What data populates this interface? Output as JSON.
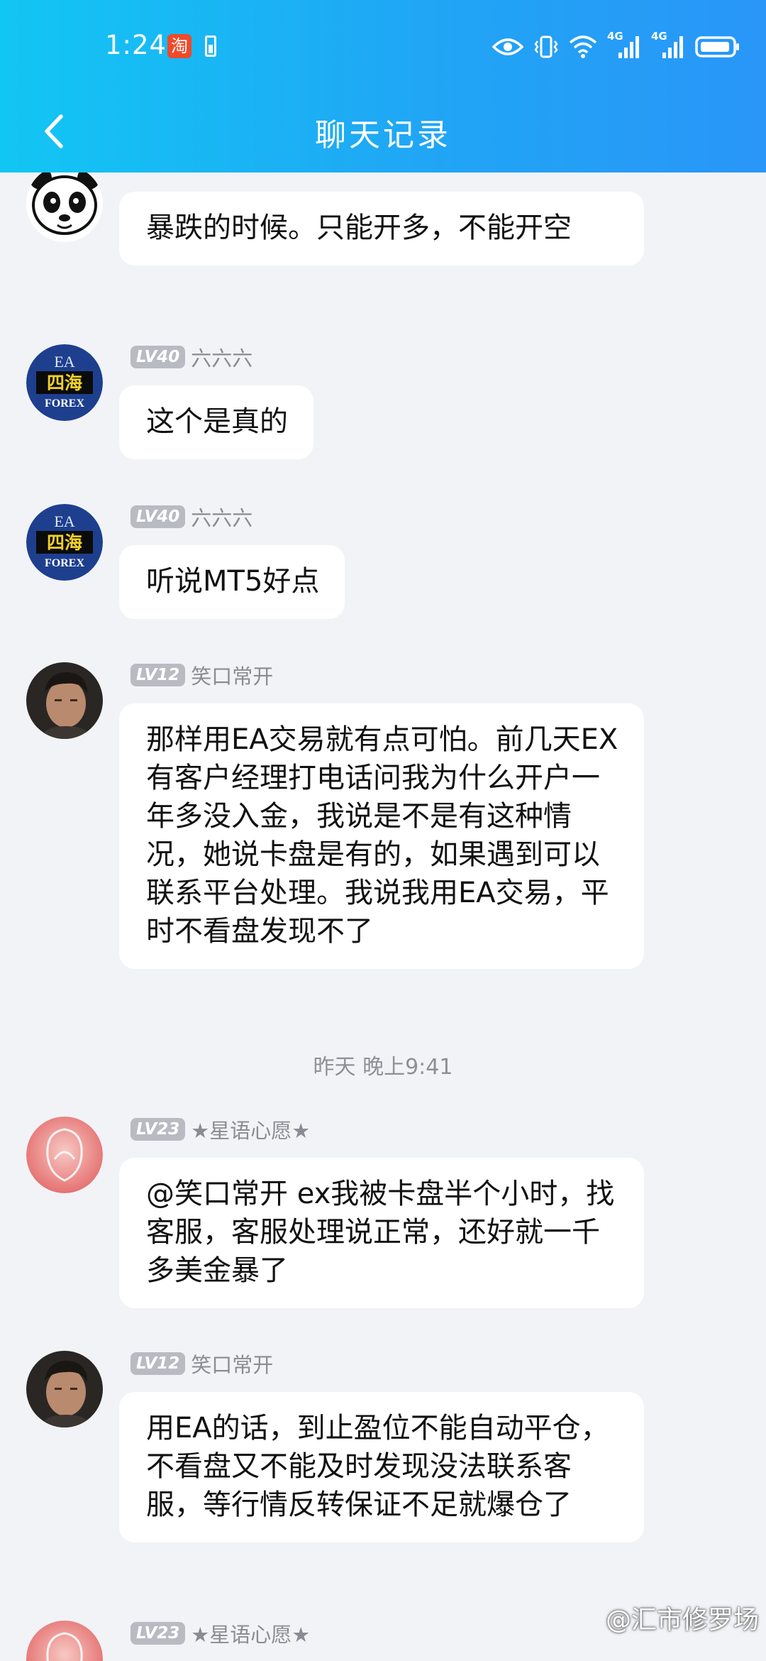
{
  "status_bar": {
    "time": "1:24",
    "taobao_glyph": "淘",
    "signal_label_1": "4G",
    "signal_label_2": "4G",
    "icons": [
      "taobao-icon",
      "battery-saver-icon",
      "eye-icon",
      "vibrate-icon",
      "wifi-icon",
      "signal-icon",
      "signal-icon",
      "battery-icon"
    ]
  },
  "header": {
    "title": "聊天记录",
    "back_icon": "chevron-left-icon",
    "gradient": [
      "#12c6f3",
      "#2996f8"
    ]
  },
  "messages": [
    {
      "level": "",
      "nickname": "",
      "avatar": "panda-avatar",
      "text": "暴跌的时候。只能开多，不能开空"
    },
    {
      "level": "LV40",
      "nickname": "六六六",
      "avatar": "ea-forex-avatar",
      "text": "这个是真的"
    },
    {
      "level": "LV40",
      "nickname": "六六六",
      "avatar": "ea-forex-avatar",
      "text": "听说MT5好点"
    },
    {
      "level": "LV12",
      "nickname": "笑口常开",
      "avatar": "man-photo-avatar",
      "text": "那样用EA交易就有点可怕。前几天EX有客户经理打电话问我为什么开户一年多没入金，我说是不是有这种情况，她说卡盘是有的，如果遇到可以联系平台处理。我说我用EA交易，平时不看盘发现不了"
    },
    {
      "level": "LV23",
      "nickname": "★星语心愿★",
      "avatar": "pink-figure-avatar",
      "text": "@笑口常开 ex我被卡盘半个小时，找客服，客服处理说正常，还好就一千多美金暴了"
    },
    {
      "level": "LV12",
      "nickname": "笑口常开",
      "avatar": "man-photo-avatar",
      "text": "用EA的话，到止盈位不能自动平仓，不看盘又不能及时发现没法联系客服，等行情反转保证不足就爆仓了"
    },
    {
      "level": "LV23",
      "nickname": "★星语心愿★",
      "avatar": "pink-figure-avatar",
      "text": ""
    }
  ],
  "timestamp": "昨天 晚上9:41",
  "ea_avatar_text": {
    "top": "EA",
    "middle": "四海",
    "bottom": "FOREX"
  },
  "watermark": "@汇市修罗场",
  "colors": {
    "background": "#f2f3f7",
    "bubble": "#ffffff",
    "level_badge": "#b9bbc3",
    "nickname": "#8a8c93"
  }
}
